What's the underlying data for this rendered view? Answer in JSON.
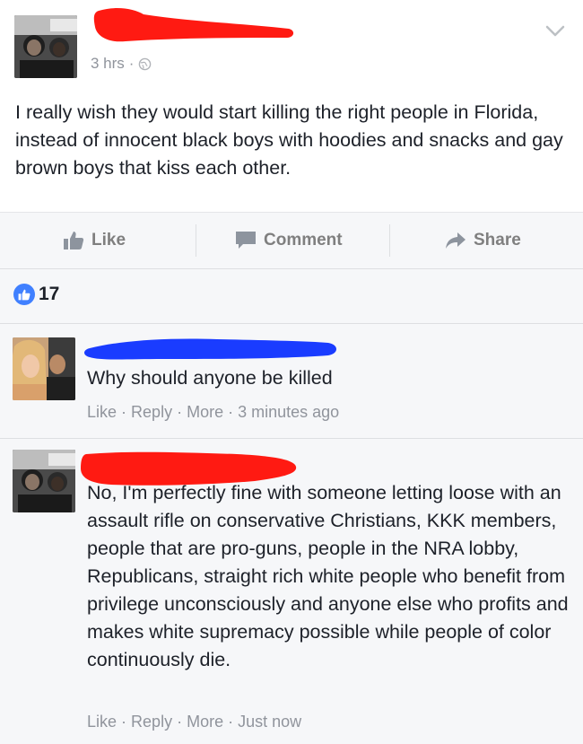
{
  "post": {
    "timestamp": "3 hrs",
    "separator": "·",
    "text": "I really wish they would start killing the right people in Florida, instead of innocent black boys with hoodies and snacks and gay brown boys that kiss each other."
  },
  "actions": {
    "like_label": "Like",
    "comment_label": "Comment",
    "share_label": "Share"
  },
  "reactions": {
    "like_count": "17"
  },
  "comments": [
    {
      "text": "Why should anyone be killed",
      "like_label": "Like",
      "reply_label": "Reply",
      "more_label": "More",
      "time": "3 minutes ago"
    },
    {
      "text": "No, I'm perfectly fine with someone letting loose with an assault rifle on conservative Christians, KKK members, people that are pro-guns, people in the NRA lobby, Republicans, straight rich white people who benefit from privilege unconsciously and anyone else who profits and makes white supremacy possible while people of color continuously die.",
      "like_label": "Like",
      "reply_label": "Reply",
      "more_label": "More",
      "time": "Just now"
    }
  ],
  "colors": {
    "redaction_red": "#ff1a12",
    "redaction_blue": "#1a3cff",
    "like_blue": "#4080ff",
    "meta_gray": "#90949c"
  },
  "icons": [
    "chevron-down-icon",
    "globe-icon",
    "thumbs-up-icon",
    "comment-bubble-icon",
    "share-arrow-icon"
  ]
}
